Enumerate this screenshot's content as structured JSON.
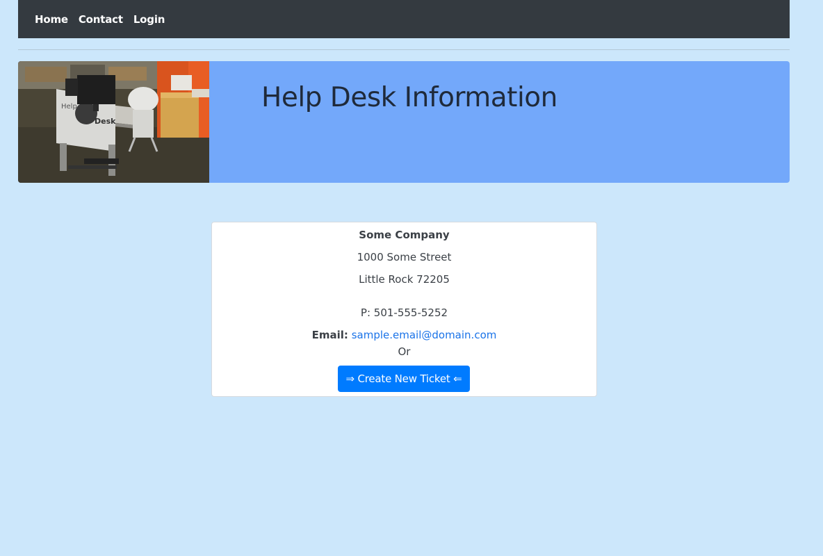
{
  "nav": {
    "items": [
      "Home",
      "Contact",
      "Login"
    ]
  },
  "banner": {
    "title": "Help Desk Information",
    "image_sign_text": "Help Desk"
  },
  "contact": {
    "company": "Some Company",
    "street": "1000 Some Street",
    "city": "Little Rock 72205",
    "phone": "P: 501-555-5252",
    "email_label": "Email:",
    "email": "sample.email@domain.com",
    "or_text": "Or",
    "ticket_button": "⇒ Create New Ticket ⇐"
  },
  "colors": {
    "page_background": "#cce7fb",
    "navbar": "#343a40",
    "banner": "#73a8fa",
    "button": "#007bff",
    "link": "#1a73e8"
  }
}
